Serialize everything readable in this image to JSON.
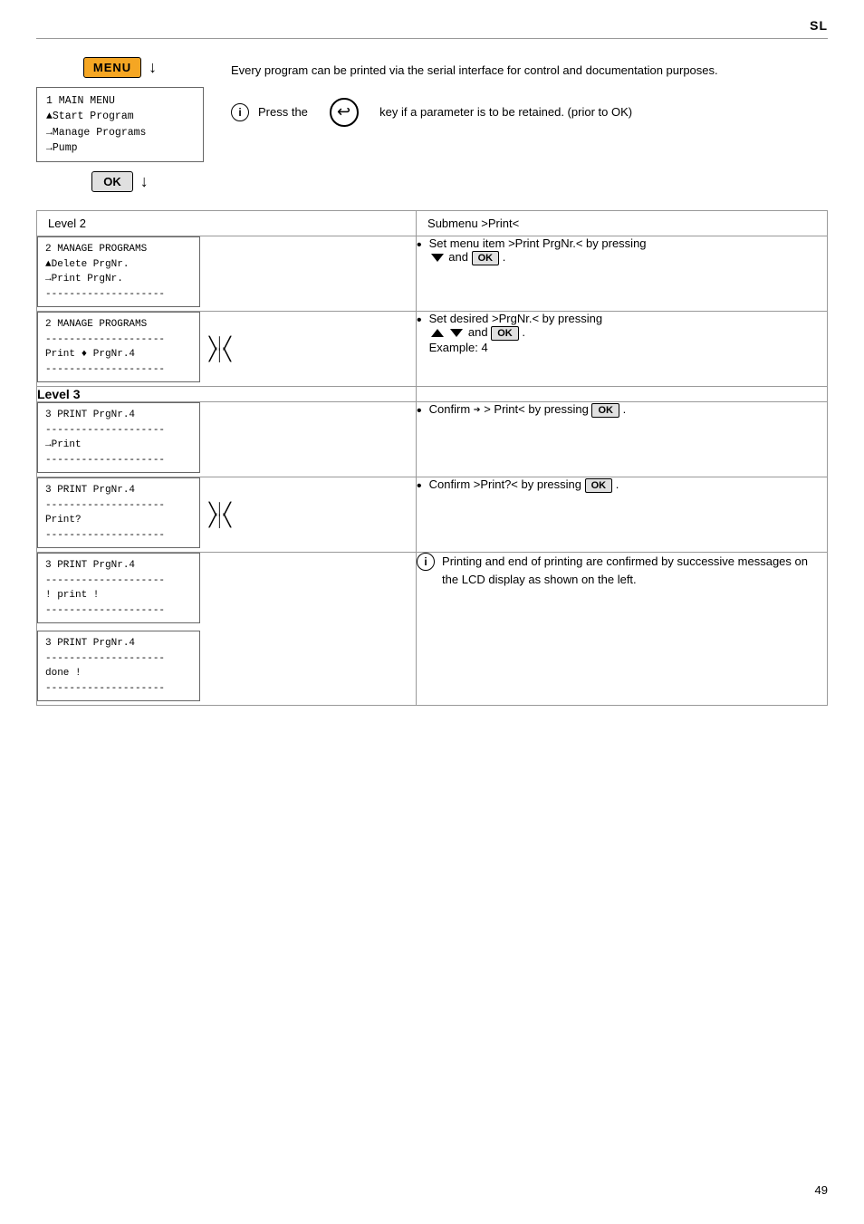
{
  "page": {
    "label": "SL",
    "page_number": "49"
  },
  "top_section": {
    "menu_button": "MENU",
    "ok_button": "OK",
    "arrow_symbol": "↓",
    "lcd_display": {
      "line1": "1 MAIN MENU",
      "line2": "▲Start Program",
      "line3": "→Manage Programs",
      "line4": "→Pump"
    },
    "intro_text": "Every program can be printed via the serial interface for control and documentation purposes.",
    "info_text": "Press the",
    "info_text2": "key if a parameter is to be retained. (prior to OK)"
  },
  "table": {
    "col1_header": "Level 2",
    "col2_header": "Submenu >Print<",
    "rows": [
      {
        "lcd": {
          "line1": "2 MANAGE PROGRAMS",
          "line2": "▲Delete     PrgNr.",
          "line3": "→Print      PrgNr.",
          "line4": "--------------------"
        },
        "bullet": "Set menu item >Print PrgNr.< by pressing",
        "bullet_suffix": "and OK ."
      },
      {
        "lcd": {
          "line1": "2 MANAGE PROGRAMS",
          "line2": "--------------------",
          "line3": "Print    ♦ PrgNr.4",
          "line4": "--------------------"
        },
        "has_nav": true,
        "bullet": "Set desired >PrgNr.< by pressing",
        "bullet_suffix": "and OK .",
        "example": "Example: 4"
      }
    ],
    "level3_label": "Level 3",
    "level3_rows": [
      {
        "lcd": {
          "line1": "3 PRINT      PrgNr.4",
          "line2": "--------------------",
          "line3": "→Print",
          "line4": "--------------------"
        },
        "bullet": "Confirm ➡ > Print< by pressing OK ."
      },
      {
        "lcd": {
          "line1": "3 PRINT      PrgNr.4",
          "line2": "--------------------",
          "line3": "Print?",
          "line4": "--------------------"
        },
        "has_nav": true,
        "bullet": "Confirm >Print?< by pressing OK ."
      },
      {
        "lcd": {
          "line1": "3 PRINT      PrgNr.4",
          "line2": "--------------------",
          "line3": "! print !",
          "line4": "--------------------"
        },
        "info": "Printing and end of printing are confirmed by successive messages on the LCD display as shown on the left."
      },
      {
        "lcd": {
          "line1": "3 PRINT      PrgNr.4",
          "line2": "--------------------",
          "line3": "done !",
          "line4": "--------------------"
        },
        "info": ""
      }
    ]
  }
}
